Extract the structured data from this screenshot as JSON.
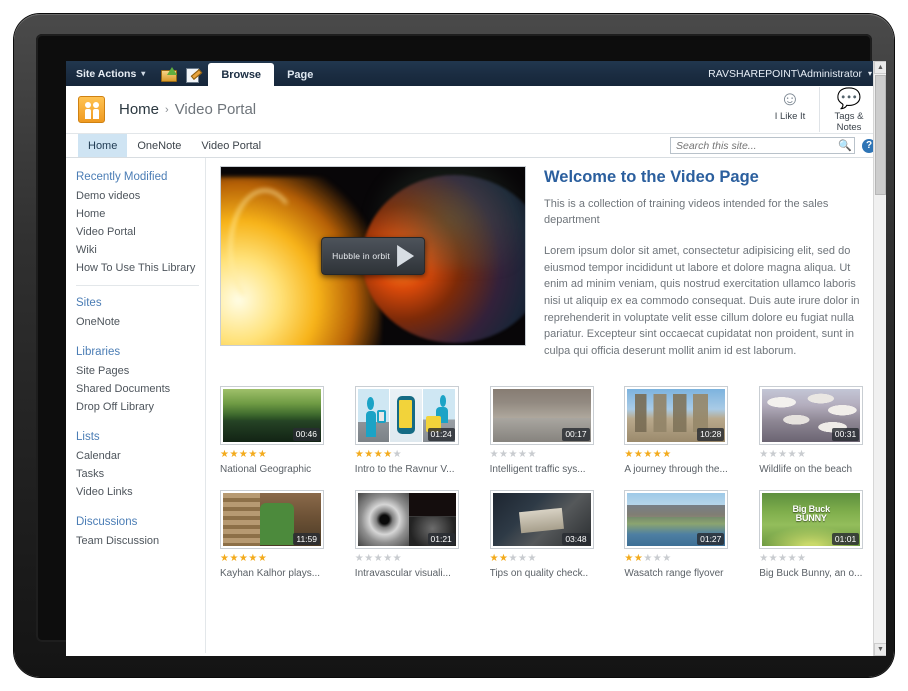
{
  "suite": {
    "site_actions": "Site Actions",
    "caret": "▾",
    "quick_icons": [
      "navigate-up-icon",
      "edit-page-icon"
    ],
    "ribbon_tabs": [
      {
        "label": "Browse",
        "active": true
      },
      {
        "label": "Page",
        "active": false
      }
    ],
    "user": "RAVSHAREPOINT\\Administrator"
  },
  "header": {
    "logo": "sharepoint-people-logo",
    "breadcrumb": {
      "home": "Home",
      "separator": "›",
      "current": "Video Portal"
    },
    "actions": [
      {
        "name": "i-like-it",
        "icon": "like-tag-icon",
        "label": "I Like It"
      },
      {
        "name": "tags-and-notes",
        "icon": "tags-notes-icon",
        "label": "Tags &\nNotes",
        "line1": "Tags &",
        "line2": "Notes"
      }
    ]
  },
  "nav": {
    "tabs": [
      {
        "label": "Home",
        "active": true
      },
      {
        "label": "OneNote",
        "active": false
      },
      {
        "label": "Video Portal",
        "active": false
      }
    ],
    "search": {
      "placeholder": "Search this site...",
      "value": "",
      "button_icon": "search-icon"
    },
    "help_icon": "help-icon",
    "help_label": "?"
  },
  "sidebar": {
    "groups": [
      {
        "heading": "Recently Modified",
        "items": [
          "Demo videos",
          "Home",
          "Video Portal",
          "Wiki",
          "How To Use This Library"
        ],
        "divider_after": true
      },
      {
        "heading": "Sites",
        "items": [
          "OneNote"
        ],
        "divider_after": false
      },
      {
        "heading": "Libraries",
        "items": [
          "Site Pages",
          "Shared Documents",
          "Drop Off Library"
        ],
        "divider_after": false
      },
      {
        "heading": "Lists",
        "items": [
          "Calendar",
          "Tasks",
          "Video Links"
        ],
        "divider_after": false
      },
      {
        "heading": "Discussions",
        "items": [
          "Team Discussion"
        ],
        "divider_after": false
      }
    ]
  },
  "hero": {
    "player": {
      "art": "space-planet-sunrise",
      "overlay_label": "Hubble in orbit",
      "play_icon": "play-triangle-icon"
    },
    "welcome": {
      "title": "Welcome to the Video Page",
      "lead": "This is a collection of training videos intended for the sales department",
      "body": "Lorem ipsum dolor sit amet, consectetur adipisicing elit, sed do eiusmod tempor incididunt ut labore et dolore magna aliqua. Ut enim ad minim veniam, quis nostrud exercitation ullamco laboris nisi ut aliquip ex ea commodo consequat. Duis aute irure dolor in reprehenderit in voluptate velit esse cillum dolore eu fugiat nulla pariatur. Excepteur sint occaecat cupidatat non proident, sunt in culpa qui officia deserunt mollit anim id est laborum."
    }
  },
  "videos": [
    {
      "title": "National Geographic",
      "duration": "00:46",
      "rating": 5,
      "art": "art-nature"
    },
    {
      "title": "Intro to the Ravnur V...",
      "duration": "01:24",
      "rating": 4,
      "art": "art-cartoon"
    },
    {
      "title": "Intelligent traffic sys...",
      "duration": "00:17",
      "rating": 0,
      "art": "art-street"
    },
    {
      "title": "A journey through the...",
      "duration": "10:28",
      "rating": 5,
      "art": "art-ruins"
    },
    {
      "title": "Wildlife on the beach",
      "duration": "00:31",
      "rating": 0,
      "art": "art-birds"
    },
    {
      "title": "Kayhan Kalhor plays...",
      "duration": "11:59",
      "rating": 5,
      "art": "art-music"
    },
    {
      "title": "Intravascular visuali...",
      "duration": "01:21",
      "rating": 0,
      "art": "art-medical"
    },
    {
      "title": "Tips on quality check..",
      "duration": "03:48",
      "rating": 2,
      "art": "art-desk"
    },
    {
      "title": "Wasatch range flyover",
      "duration": "01:27",
      "rating": 2,
      "art": "art-aerial"
    },
    {
      "title": "Big Buck Bunny, an o...",
      "duration": "01:01",
      "rating": 0,
      "art": "art-bunny",
      "overlay_text_line1": "Big Buck",
      "overlay_text_line2": "BUNNY"
    }
  ],
  "scrollbar": {
    "up_arrow": "▲",
    "down_arrow": "▼"
  },
  "colors": {
    "suite_bar": "#1b2d42",
    "accent_blue": "#2b5f9e",
    "nav_active": "#cfe4f3",
    "star_on": "#f3ab1d",
    "star_off": "#c9ccd0",
    "logo_orange": "#ef9a21"
  }
}
